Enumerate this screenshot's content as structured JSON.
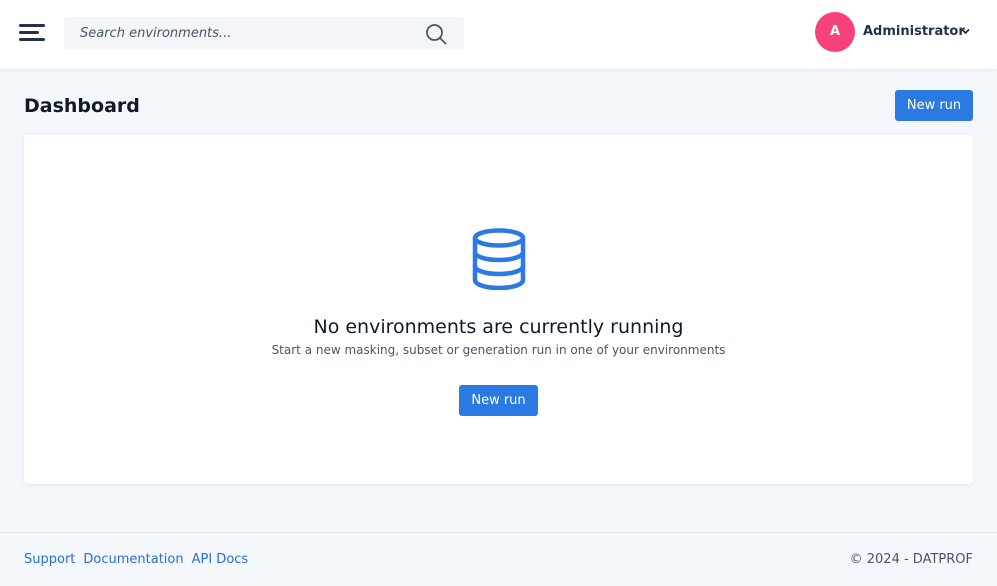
{
  "header": {
    "search_placeholder": "Search environments...",
    "user": {
      "initial": "A",
      "name": "Administrator",
      "avatar_color": "#f6417a"
    },
    "icons": {
      "menu": "hamburger-menu-icon",
      "search": "search-icon",
      "user_menu": "chevron-down-icon"
    }
  },
  "page": {
    "title": "Dashboard",
    "new_run_label": "New run"
  },
  "empty_state": {
    "icon": "database-icon",
    "title": "No environments are currently running",
    "subtitle": "Start a new masking, subset or generation run in one of your environments",
    "button_label": "New run"
  },
  "footer": {
    "links": [
      "Support",
      "Documentation",
      "API Docs"
    ],
    "copyright": "© 2024 - DATPROF"
  },
  "colors": {
    "accent": "#2b7ae4",
    "background": "#f4f7fb",
    "link": "#2b6fd6"
  }
}
